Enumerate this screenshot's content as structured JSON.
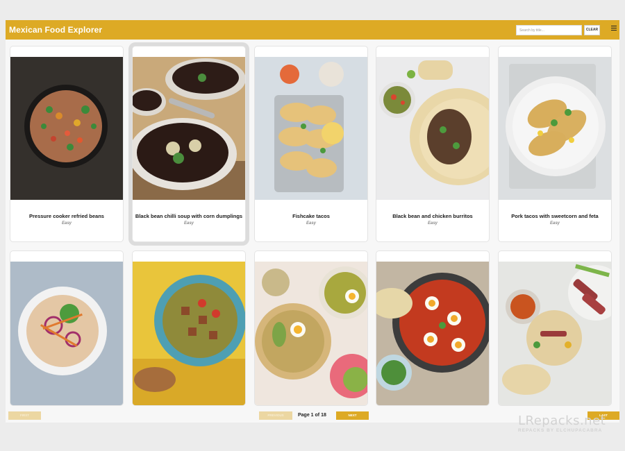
{
  "header": {
    "title": "Mexican Food Explorer",
    "search_placeholder": "Search by title...",
    "search_value": "",
    "clear_label": "CLEAR",
    "menu_icon": "hamburger-menu-icon",
    "accent_color": "#ddaa25"
  },
  "recipes": [
    {
      "title": "Pressure cooker refried beans",
      "difficulty": "Easy"
    },
    {
      "title": "Black bean chilli soup with corn dumplings",
      "difficulty": "Easy"
    },
    {
      "title": "Fishcake tacos",
      "difficulty": "Easy"
    },
    {
      "title": "Black bean and chicken burritos",
      "difficulty": "Easy"
    },
    {
      "title": "Pork tacos with sweetcorn and feta",
      "difficulty": "Easy"
    }
  ],
  "pagination": {
    "first_label": "FIRST",
    "prev_label": "PREVIOUS",
    "page_label": "Page 1 of 18",
    "next_label": "NEXT",
    "last_label": "LAST"
  },
  "watermark": {
    "line1": "LRepacks.net",
    "line2": "REPACKS BY ELCHUPACABRA"
  }
}
